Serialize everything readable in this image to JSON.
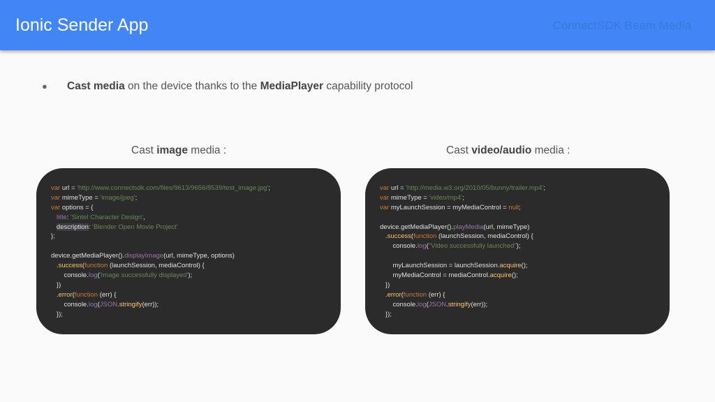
{
  "header": {
    "title": "Ionic Sender App",
    "right_label": "ConnectSDK Beam Media"
  },
  "bullet": {
    "bold1": "Cast media",
    "text1": " on the device thanks to the ",
    "bold2": "MediaPlayer",
    "text2": " capability protocol"
  },
  "captions": {
    "left_pre": "Cast ",
    "left_bold": "image",
    "left_post": " media :",
    "right_pre": "Cast ",
    "right_bold": "video/audio",
    "right_post": " media :"
  },
  "code_image": [
    [
      [
        "kw",
        "var"
      ],
      [
        "t",
        " url = "
      ],
      [
        "str",
        "'http://www.connectsdk.com/files/9613/9656/8539/test_image.jpg'"
      ],
      [
        "t",
        ";"
      ]
    ],
    [
      [
        "kw",
        "var"
      ],
      [
        "t",
        " mimeType = "
      ],
      [
        "str",
        "'image/jpeg'"
      ],
      [
        "t",
        ";"
      ]
    ],
    [
      [
        "kw",
        "var"
      ],
      [
        "t",
        " options = {"
      ]
    ],
    [
      [
        "t",
        "   "
      ],
      [
        "prop",
        "title"
      ],
      [
        "t",
        ": "
      ],
      [
        "str",
        "'Sintel Character Design'"
      ],
      [
        "t",
        ","
      ]
    ],
    [
      [
        "t",
        "   "
      ],
      [
        "hl",
        "description"
      ],
      [
        "t",
        ": "
      ],
      [
        "str",
        "'Blender Open Movie Project'"
      ]
    ],
    [
      [
        "t",
        "};"
      ]
    ],
    [
      [
        "t",
        ""
      ]
    ],
    [
      [
        "t",
        "device.getMediaPlayer()."
      ],
      [
        "fn",
        "displayImage"
      ],
      [
        "t",
        "(url, mimeType, options)"
      ]
    ],
    [
      [
        "t",
        "   ."
      ],
      [
        "fy",
        "success"
      ],
      [
        "t",
        "("
      ],
      [
        "kw",
        "function"
      ],
      [
        "t",
        " (launchSession, mediaControl) {"
      ]
    ],
    [
      [
        "t",
        "       console."
      ],
      [
        "fn",
        "log"
      ],
      [
        "t",
        "("
      ],
      [
        "str",
        "'Image successfully displayed'"
      ],
      [
        "t",
        ");"
      ]
    ],
    [
      [
        "t",
        "   })"
      ]
    ],
    [
      [
        "t",
        "   ."
      ],
      [
        "fy",
        "error"
      ],
      [
        "t",
        "("
      ],
      [
        "kw",
        "function"
      ],
      [
        "t",
        " (err) {"
      ]
    ],
    [
      [
        "t",
        "       console."
      ],
      [
        "fn",
        "log"
      ],
      [
        "t",
        "("
      ],
      [
        "fn",
        "JSON"
      ],
      [
        "t",
        "."
      ],
      [
        "fy",
        "stringify"
      ],
      [
        "t",
        "(err));"
      ]
    ],
    [
      [
        "t",
        "   });"
      ]
    ]
  ],
  "code_video": [
    [
      [
        "kw",
        "var"
      ],
      [
        "t",
        " url = "
      ],
      [
        "str",
        "'http://media.w3.org/2010/05/bunny/trailer.mp4'"
      ],
      [
        "t",
        ";"
      ]
    ],
    [
      [
        "kw",
        "var"
      ],
      [
        "t",
        " mimeType = "
      ],
      [
        "str",
        "'video/mp4'"
      ],
      [
        "t",
        ";"
      ]
    ],
    [
      [
        "kw",
        "var"
      ],
      [
        "t",
        " myLaunchSession = myMediaControl = "
      ],
      [
        "kw",
        "null"
      ],
      [
        "t",
        ";"
      ]
    ],
    [
      [
        "t",
        ""
      ]
    ],
    [
      [
        "t",
        "device.getMediaPlayer()."
      ],
      [
        "fn",
        "playMedia"
      ],
      [
        "t",
        "(url, mimeType)"
      ]
    ],
    [
      [
        "t",
        "   ."
      ],
      [
        "fy",
        "success"
      ],
      [
        "t",
        "("
      ],
      [
        "kw",
        "function"
      ],
      [
        "t",
        " (launchSession, mediaControl) {"
      ]
    ],
    [
      [
        "t",
        "       console."
      ],
      [
        "fn",
        "log"
      ],
      [
        "t",
        "("
      ],
      [
        "str",
        "\"Video successfully launched\""
      ],
      [
        "t",
        ");"
      ]
    ],
    [
      [
        "t",
        ""
      ]
    ],
    [
      [
        "t",
        "       myLaunchSession = launchSession."
      ],
      [
        "fy",
        "acquire"
      ],
      [
        "t",
        "();"
      ]
    ],
    [
      [
        "t",
        "       myMediaControl = mediaControl."
      ],
      [
        "fy",
        "acquire"
      ],
      [
        "t",
        "();"
      ]
    ],
    [
      [
        "t",
        "   })"
      ]
    ],
    [
      [
        "t",
        "   ."
      ],
      [
        "fy",
        "error"
      ],
      [
        "t",
        "("
      ],
      [
        "kw",
        "function"
      ],
      [
        "t",
        " (err) {"
      ]
    ],
    [
      [
        "t",
        "       console."
      ],
      [
        "fn",
        "log"
      ],
      [
        "t",
        "("
      ],
      [
        "fn",
        "JSON"
      ],
      [
        "t",
        "."
      ],
      [
        "fy",
        "stringify"
      ],
      [
        "t",
        "(err));"
      ]
    ],
    [
      [
        "t",
        "   });"
      ]
    ]
  ]
}
